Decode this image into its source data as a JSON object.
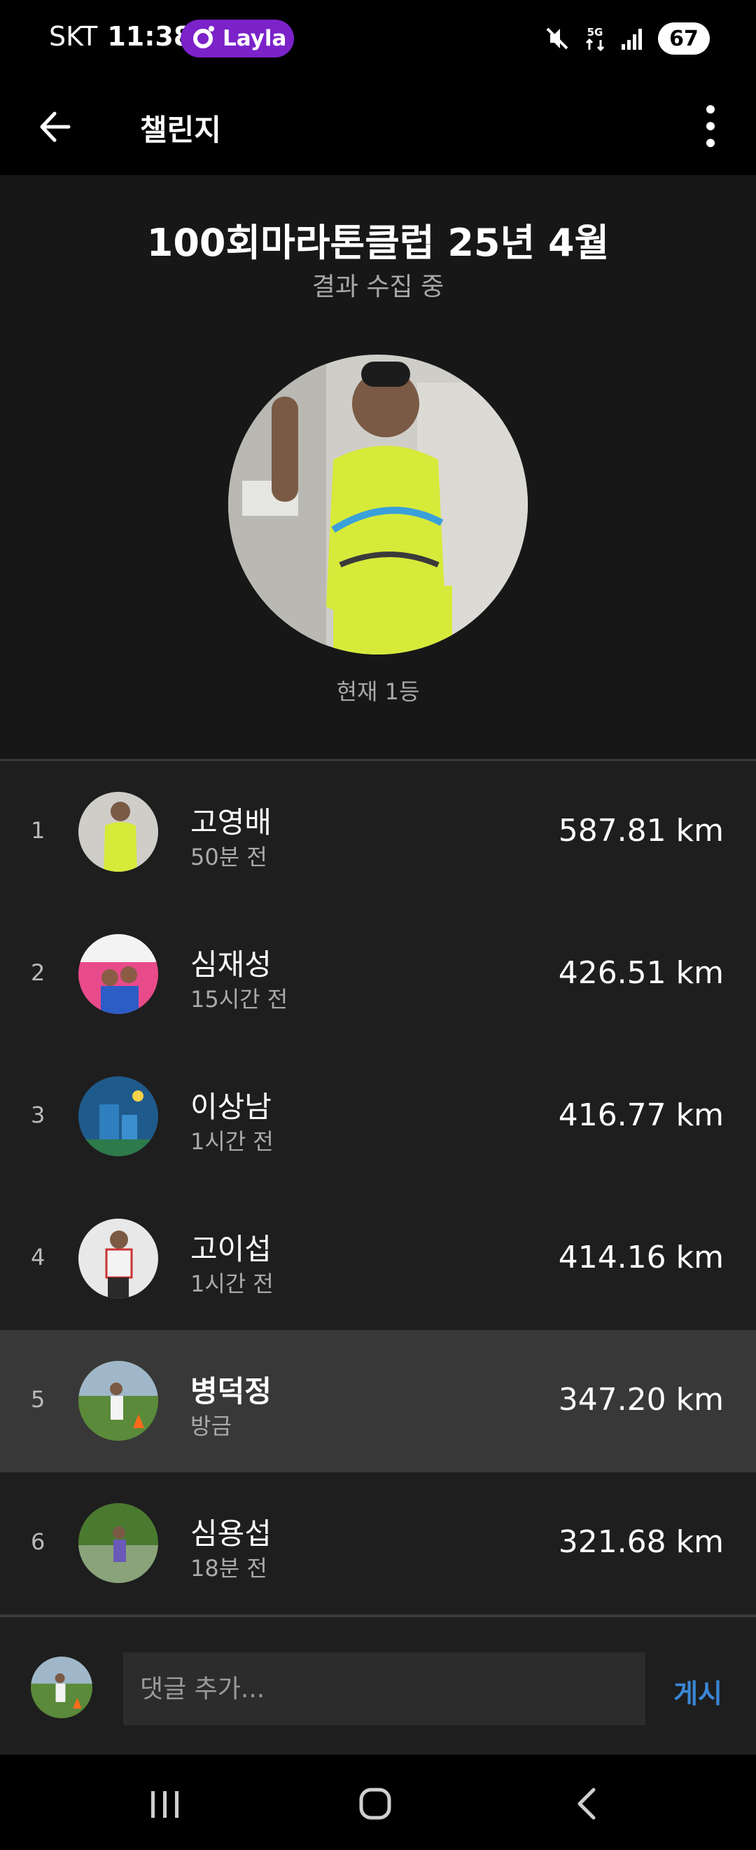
{
  "status_bar": {
    "carrier": "SKT",
    "time": "11:38",
    "pill_label": "Layla",
    "battery": "67"
  },
  "app_bar": {
    "title": "챌린지"
  },
  "challenge": {
    "title": "100회마라톤클럽 25년 4월",
    "status": "결과 수집 중",
    "current_rank": "현재 1등"
  },
  "leaderboard": [
    {
      "rank": "1",
      "name": "고영배",
      "updated": "50분 전",
      "distance": "587.81 km"
    },
    {
      "rank": "2",
      "name": "심재성",
      "updated": "15시간 전",
      "distance": "426.51 km"
    },
    {
      "rank": "3",
      "name": "이상남",
      "updated": "1시간 전",
      "distance": "416.77 km"
    },
    {
      "rank": "4",
      "name": "고이섭",
      "updated": "1시간 전",
      "distance": "414.16 km"
    },
    {
      "rank": "5",
      "name": "병덕정",
      "updated": "방금",
      "distance": "347.20 km",
      "highlighted": true
    },
    {
      "rank": "6",
      "name": "심용섭",
      "updated": "18분 전",
      "distance": "321.68 km"
    }
  ],
  "comment": {
    "placeholder": "댓글 추가...",
    "post_label": "게시"
  },
  "colors": {
    "accent": "#3a86d4",
    "pill": "#7b22c9",
    "highlight_row": "#383838",
    "list_bg": "#1e1e1e",
    "hero_bg": "#171717"
  },
  "icons": [
    "back-arrow-icon",
    "more-vert-icon",
    "mute-icon",
    "5g-icon",
    "signal-icon",
    "battery-icon",
    "recents-icon",
    "home-icon",
    "nav-back-icon"
  ]
}
